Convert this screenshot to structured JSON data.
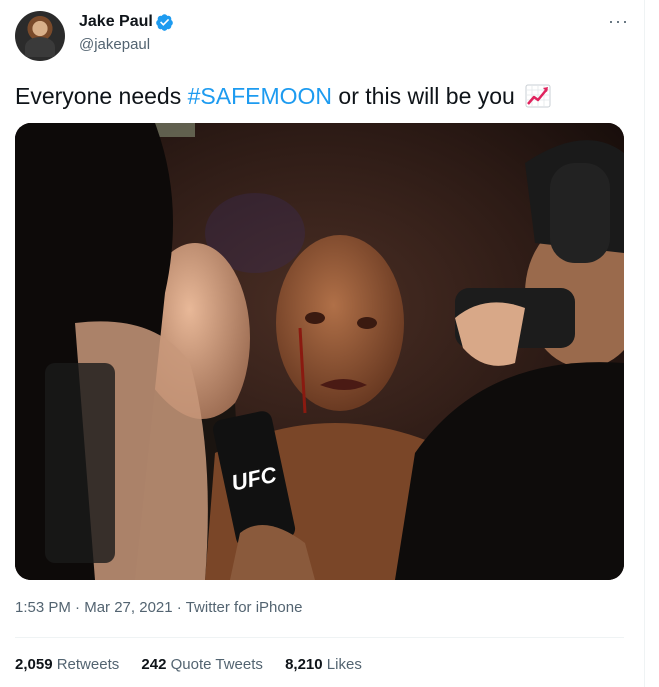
{
  "author": {
    "name": "Jake Paul",
    "handle": "@jakepaul",
    "verified": true
  },
  "more_icon": "more-options-icon",
  "tweet": {
    "text_before": "Everyone needs ",
    "hashtag": "#SAFEMOON",
    "text_after": " or this will be you",
    "emoji": "chart-increasing-icon"
  },
  "media": {
    "type": "photo",
    "overlay_text": "UFC"
  },
  "meta": {
    "time": "1:53 PM",
    "date": "Mar 27, 2021",
    "source": "Twitter for iPhone",
    "dot": "·"
  },
  "stats": {
    "retweets_count": "2,059",
    "retweets_label": "Retweets",
    "quotes_count": "242",
    "quotes_label": "Quote Tweets",
    "likes_count": "8,210",
    "likes_label": "Likes"
  },
  "colors": {
    "accent": "#1d9bf0",
    "text": "#0f1419",
    "secondary": "#536471"
  }
}
